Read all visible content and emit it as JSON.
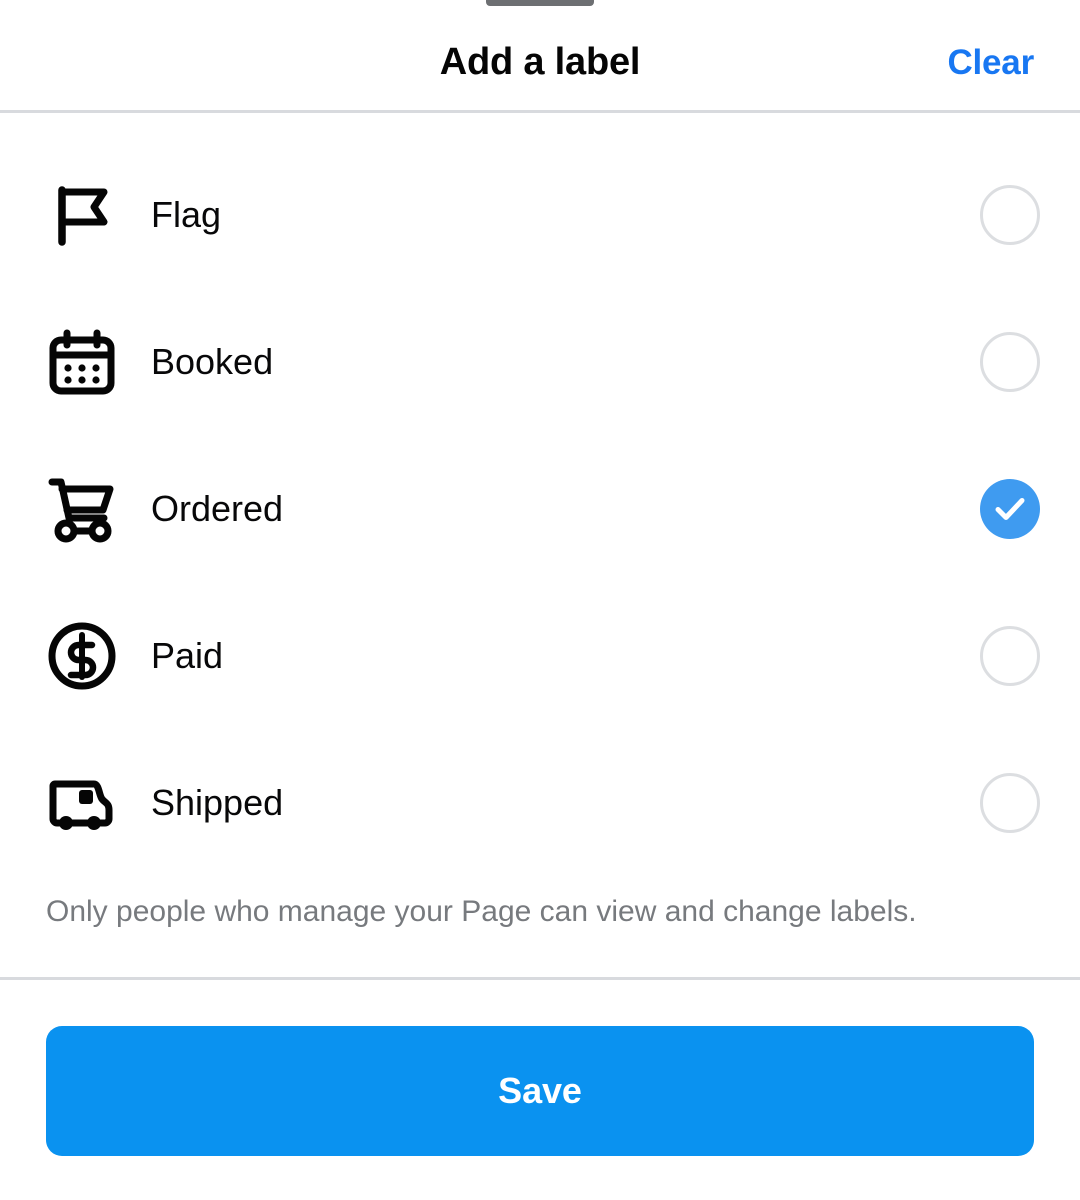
{
  "sheet": {
    "drag_handle": "drag-handle"
  },
  "header": {
    "title": "Add a label",
    "clear_label": "Clear"
  },
  "labels": {
    "items": [
      {
        "id": "flag",
        "label": "Flag",
        "icon": "flag-icon",
        "selected": false
      },
      {
        "id": "booked",
        "label": "Booked",
        "icon": "calendar-icon",
        "selected": false
      },
      {
        "id": "ordered",
        "label": "Ordered",
        "icon": "shopping-cart-icon",
        "selected": true
      },
      {
        "id": "paid",
        "label": "Paid",
        "icon": "dollar-circle-icon",
        "selected": false
      },
      {
        "id": "shipped",
        "label": "Shipped",
        "icon": "delivery-truck-icon",
        "selected": false
      }
    ]
  },
  "footnote": {
    "text": "Only people who manage your Page can view and change labels."
  },
  "footer": {
    "save_label": "Save"
  },
  "colors": {
    "accent_blue": "#1877f2",
    "selected_blue": "#3f9bf0",
    "save_blue": "#0a92f0",
    "radio_border": "#dcdee1",
    "divider": "#d8dade",
    "text_primary": "#080809",
    "text_muted": "#777a7e"
  }
}
